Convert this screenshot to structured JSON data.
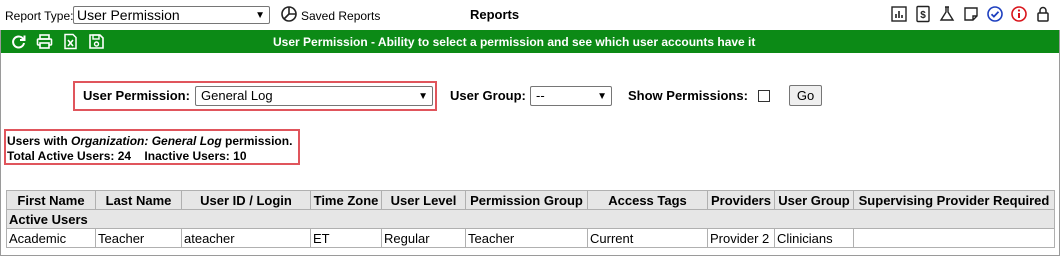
{
  "toolbar": {
    "report_type_label": "Report Type:",
    "report_type_value": "User Permission",
    "saved_reports_label": "Saved Reports",
    "page_title": "Reports"
  },
  "banner": {
    "title": "User Permission - Ability to select a permission and see which user accounts have it"
  },
  "filters": {
    "permission_label": "User Permission:",
    "permission_value": "General Log",
    "user_group_label": "User Group:",
    "user_group_value": "--",
    "show_permissions_label": "Show Permissions:",
    "show_permissions_checked": false,
    "go_label": "Go"
  },
  "summary": {
    "prefix": "Users with ",
    "permission": "Organization: General Log",
    "suffix": " permission.",
    "total_active_label": "Total Active Users:",
    "total_active": "24",
    "inactive_label": "Inactive Users:",
    "inactive": "10"
  },
  "table": {
    "columns": [
      "First Name",
      "Last Name",
      "User ID / Login",
      "Time Zone",
      "User Level",
      "Permission Group",
      "Access Tags",
      "Providers",
      "User Group",
      "Supervising Provider Required"
    ],
    "group_label": "Active Users",
    "rows": [
      [
        "Academic",
        "Teacher",
        "ateacher",
        "ET",
        "Regular",
        "Teacher",
        "Current",
        "Provider 2",
        "Clinicians",
        ""
      ]
    ]
  },
  "colors": {
    "banner_bg": "#0c8a16",
    "highlight": "#e0555c"
  }
}
